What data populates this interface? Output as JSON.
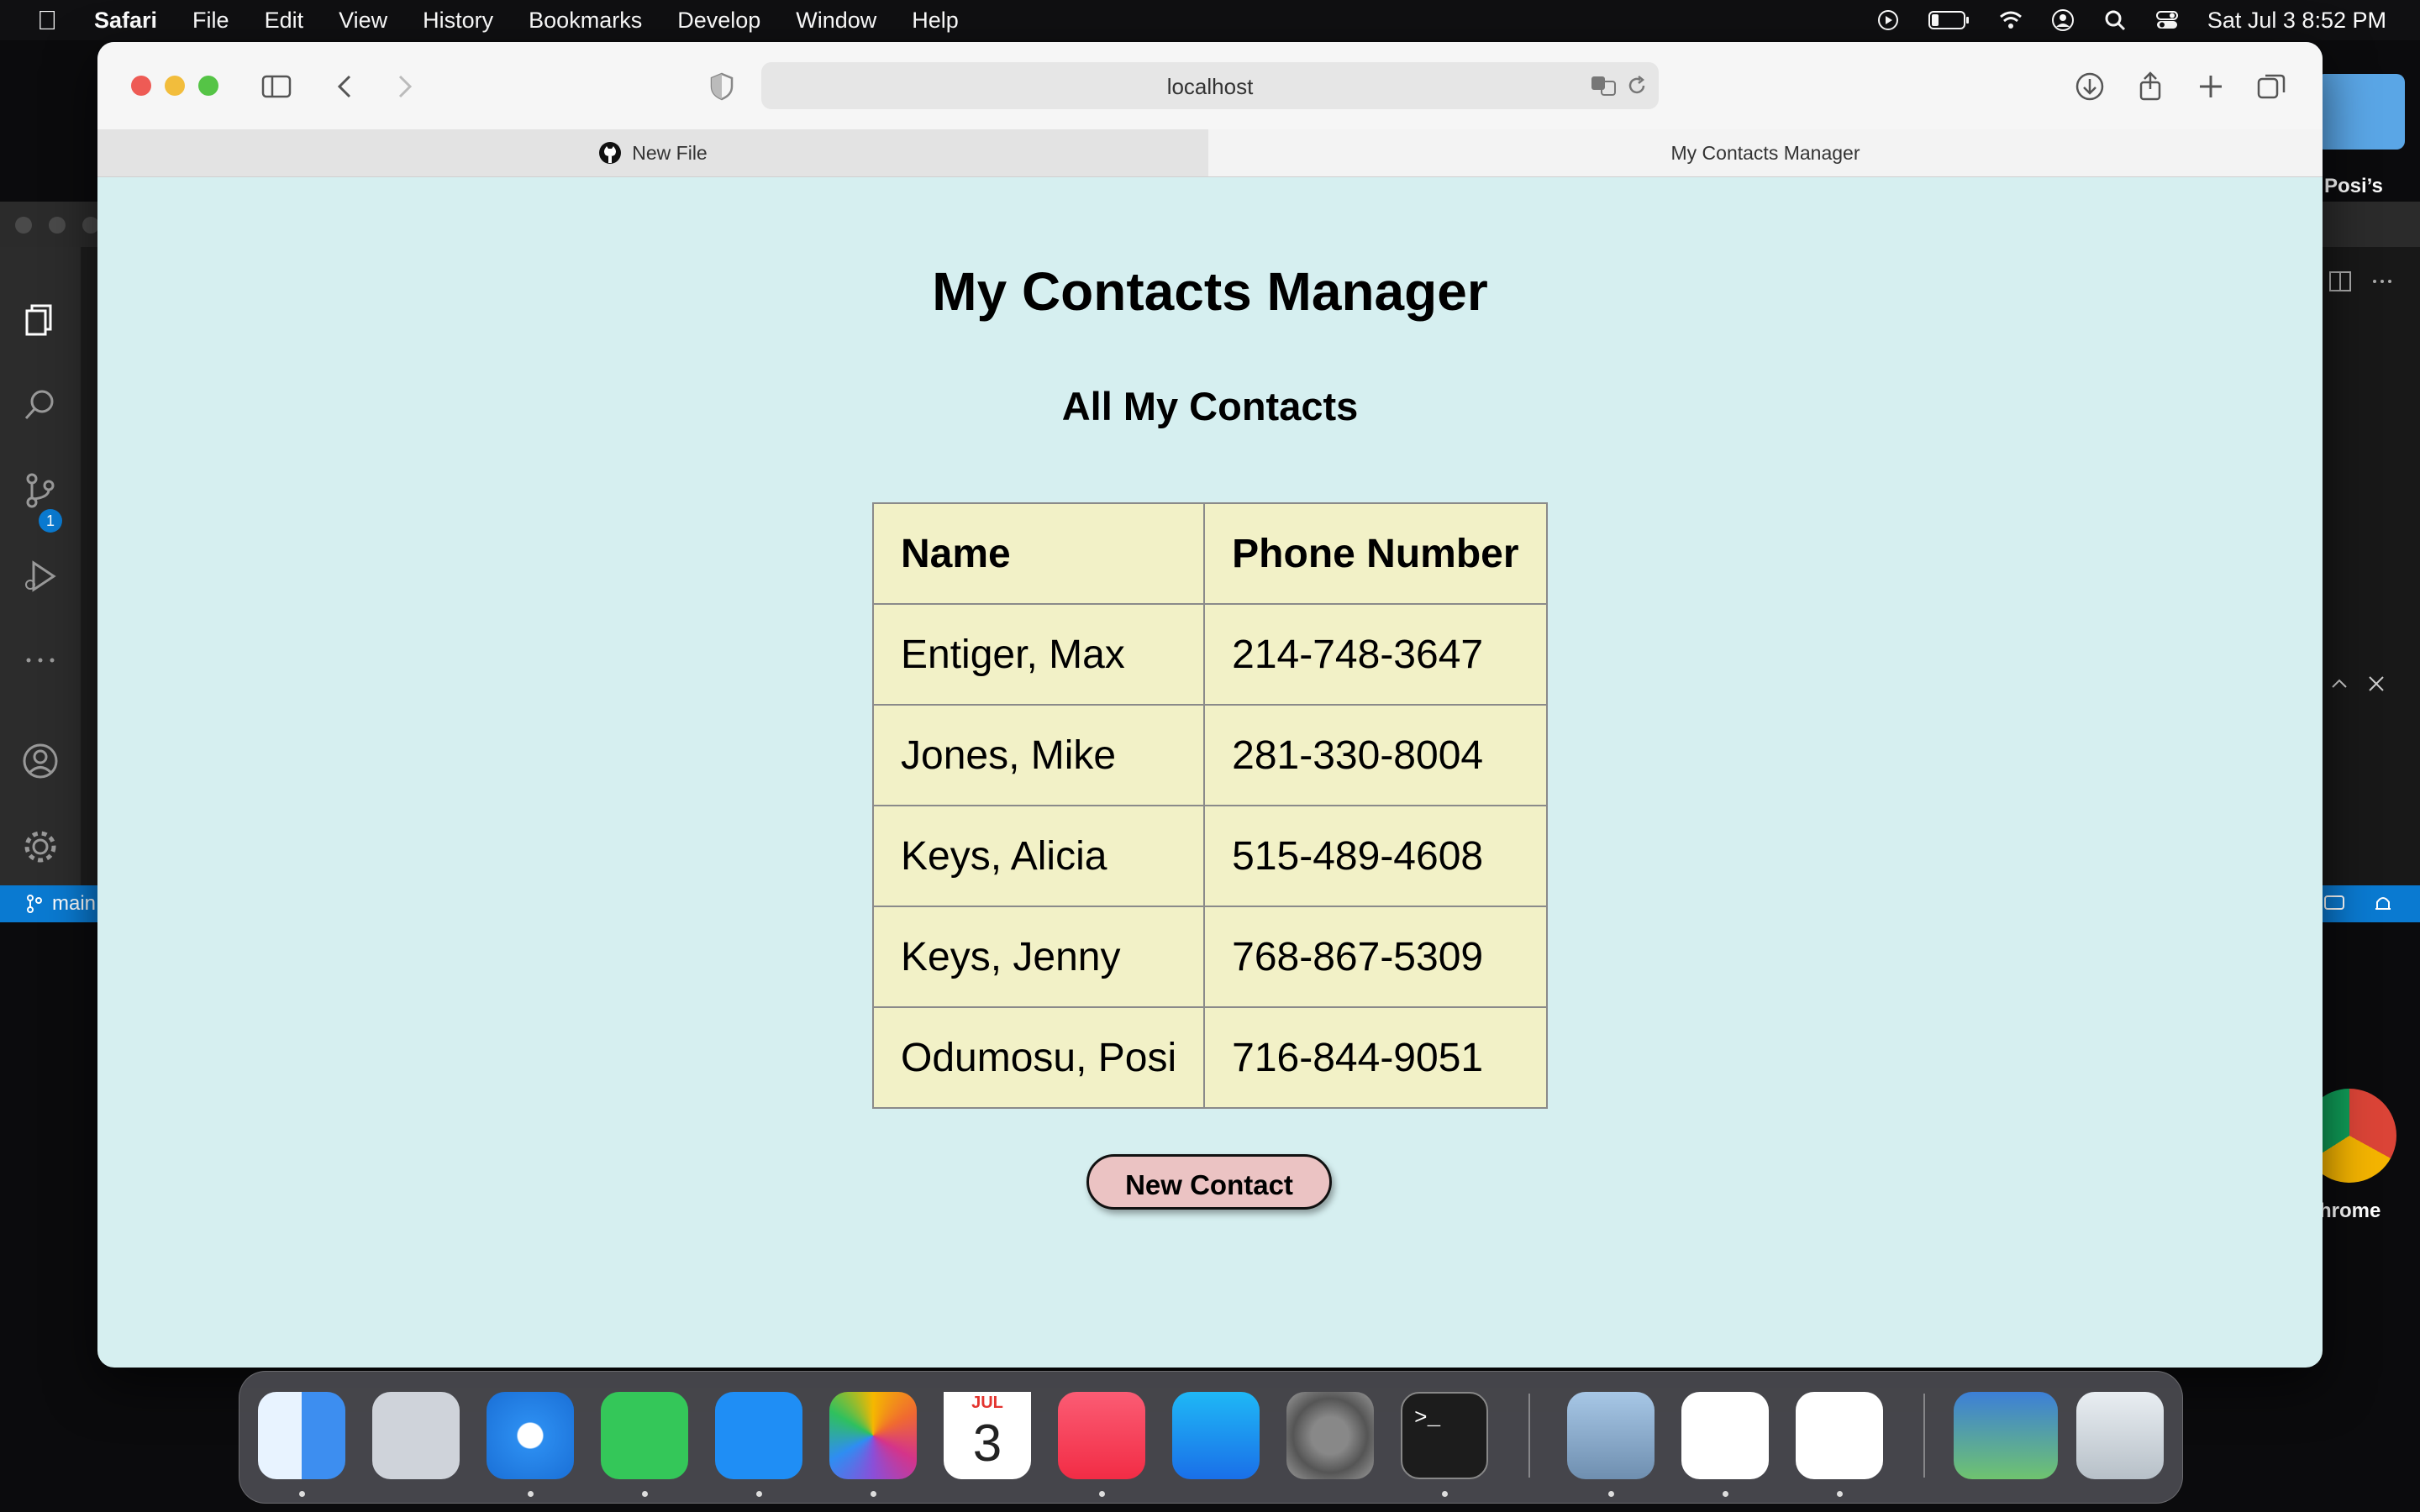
{
  "menubar": {
    "apple": "",
    "app_name": "Safari",
    "items": [
      "File",
      "Edit",
      "View",
      "History",
      "Bookmarks",
      "Develop",
      "Window",
      "Help"
    ],
    "datetime": "Sat Jul 3  8:52 PM"
  },
  "background_app": {
    "vscode_branch": "main",
    "scm_badge": "1",
    "desktop_label_top": "Posi’s",
    "desktop_label_chrome": "hrome"
  },
  "browser": {
    "url": "localhost",
    "tabs": [
      {
        "label": "New File",
        "icon": "github-icon",
        "active": false
      },
      {
        "label": "My Contacts Manager",
        "active": true
      }
    ]
  },
  "page": {
    "title": "My Contacts Manager",
    "subtitle": "All My Contacts",
    "table": {
      "headers": [
        "Name",
        "Phone Number"
      ],
      "rows": [
        [
          "Entiger, Max",
          "214-748-3647"
        ],
        [
          "Jones, Mike",
          "281-330-8004"
        ],
        [
          "Keys, Alicia",
          "515-489-4608"
        ],
        [
          "Keys, Jenny",
          "768-867-5309"
        ],
        [
          "Odumosu, Posi",
          "716-844-9051"
        ]
      ]
    },
    "new_contact_label": "New Contact"
  },
  "dock": {
    "calendar_month": "JUL",
    "calendar_day": "3",
    "terminal_prompt": ">_",
    "apps": [
      "finder",
      "launchpad",
      "safari",
      "messages",
      "mail",
      "photos",
      "calendar",
      "music",
      "app-store",
      "system-preferences",
      "terminal",
      "preview",
      "wps-office",
      "vscode",
      "screenshot",
      "trash"
    ]
  },
  "colors": {
    "page_background": "#d6eff0",
    "table_background": "#f2f1c7",
    "button_background": "#ebc3c3",
    "vscode_statusbar": "#0a7ad1"
  }
}
